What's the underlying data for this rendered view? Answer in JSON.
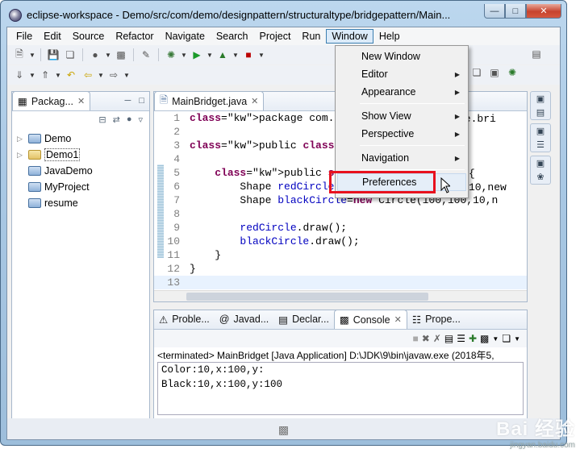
{
  "window": {
    "title": "eclipse-workspace - Demo/src/com/demo/designpattern/structuraltype/bridgepattern/Main..."
  },
  "menubar": [
    "File",
    "Edit",
    "Source",
    "Refactor",
    "Navigate",
    "Search",
    "Project",
    "Run",
    "Window",
    "Help"
  ],
  "explorer": {
    "tab_label": "Packag...",
    "items": [
      {
        "label": "Demo",
        "kind": "project",
        "expandable": true
      },
      {
        "label": "Demo1",
        "kind": "project",
        "expandable": true
      },
      {
        "label": "JavaDemo",
        "kind": "folder",
        "expandable": false
      },
      {
        "label": "MyProject",
        "kind": "folder",
        "expandable": false
      },
      {
        "label": "resume",
        "kind": "folder",
        "expandable": false
      }
    ]
  },
  "editor": {
    "tab_label": "MainBridget.java",
    "lines": [
      {
        "n": "1",
        "text": "package com.demo.design"
      },
      {
        "n": "2",
        "text": ""
      },
      {
        "n": "3",
        "text": "public class MainBridge"
      },
      {
        "n": "4",
        "text": ""
      },
      {
        "n": "5",
        "text": "    public static void"
      },
      {
        "n": "6",
        "text": "        Shape redCircle"
      },
      {
        "n": "7",
        "text": "        Shape blackCircle=new Circle(100,100,10,n"
      },
      {
        "n": "8",
        "text": ""
      },
      {
        "n": "9",
        "text": "        redCircle.draw();"
      },
      {
        "n": "10",
        "text": "        blackCircle.draw();"
      },
      {
        "n": "11",
        "text": "    }"
      },
      {
        "n": "12",
        "text": "}"
      },
      {
        "n": "13",
        "text": ""
      }
    ],
    "right_fragments": {
      "line1": "pe.bri",
      "line5": "{",
      "line6": "10,new"
    }
  },
  "bottom_tabs": [
    "Proble...",
    "Javad...",
    "Declar...",
    "Console",
    "Prope..."
  ],
  "console": {
    "status": "<terminated> MainBridget [Java Application] D:\\JDK\\9\\bin\\javaw.exe (2018年5,",
    "output": [
      "Color:10,x:100,y:",
      "Black:10,x:100,y:100"
    ]
  },
  "window_menu": {
    "items": [
      "New Window",
      "Editor",
      "Appearance",
      "Show View",
      "Perspective",
      "Navigation",
      "Preferences"
    ],
    "submenu_items": [
      "Editor",
      "Appearance",
      "Show View",
      "Perspective",
      "Navigation"
    ],
    "highlighted": "Preferences"
  },
  "watermark": {
    "brand": "Bai 经验",
    "url": "jingyan.baidu.com"
  },
  "colors": {
    "highlight_border": "#e8111e",
    "keyword": "#7f0055"
  }
}
